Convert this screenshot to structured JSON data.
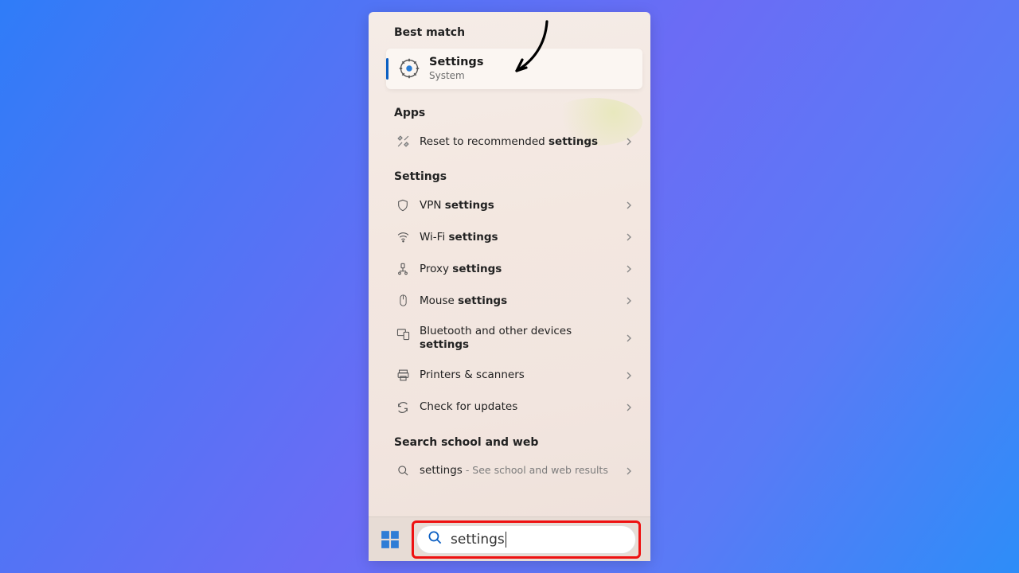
{
  "sections": {
    "best_match": "Best match",
    "apps": "Apps",
    "settings": "Settings",
    "search_web": "Search school and web"
  },
  "best": {
    "title": "Settings",
    "subtitle": "System"
  },
  "apps_rows": [
    {
      "prefix": "Reset to recommended ",
      "bold": "settings"
    }
  ],
  "settings_rows": [
    {
      "prefix": "VPN ",
      "bold": "settings"
    },
    {
      "prefix": "Wi-Fi ",
      "bold": "settings"
    },
    {
      "prefix": "Proxy ",
      "bold": "settings"
    },
    {
      "prefix": "Mouse ",
      "bold": "settings"
    },
    {
      "prefix": "Bluetooth and other devices ",
      "bold": "settings",
      "wrap": true
    },
    {
      "prefix": "Printers & scanners",
      "bold": ""
    },
    {
      "prefix": "Check for updates",
      "bold": ""
    }
  ],
  "web_row": {
    "term": "settings",
    "suffix": " - See school and web results"
  },
  "search_value": "settings"
}
